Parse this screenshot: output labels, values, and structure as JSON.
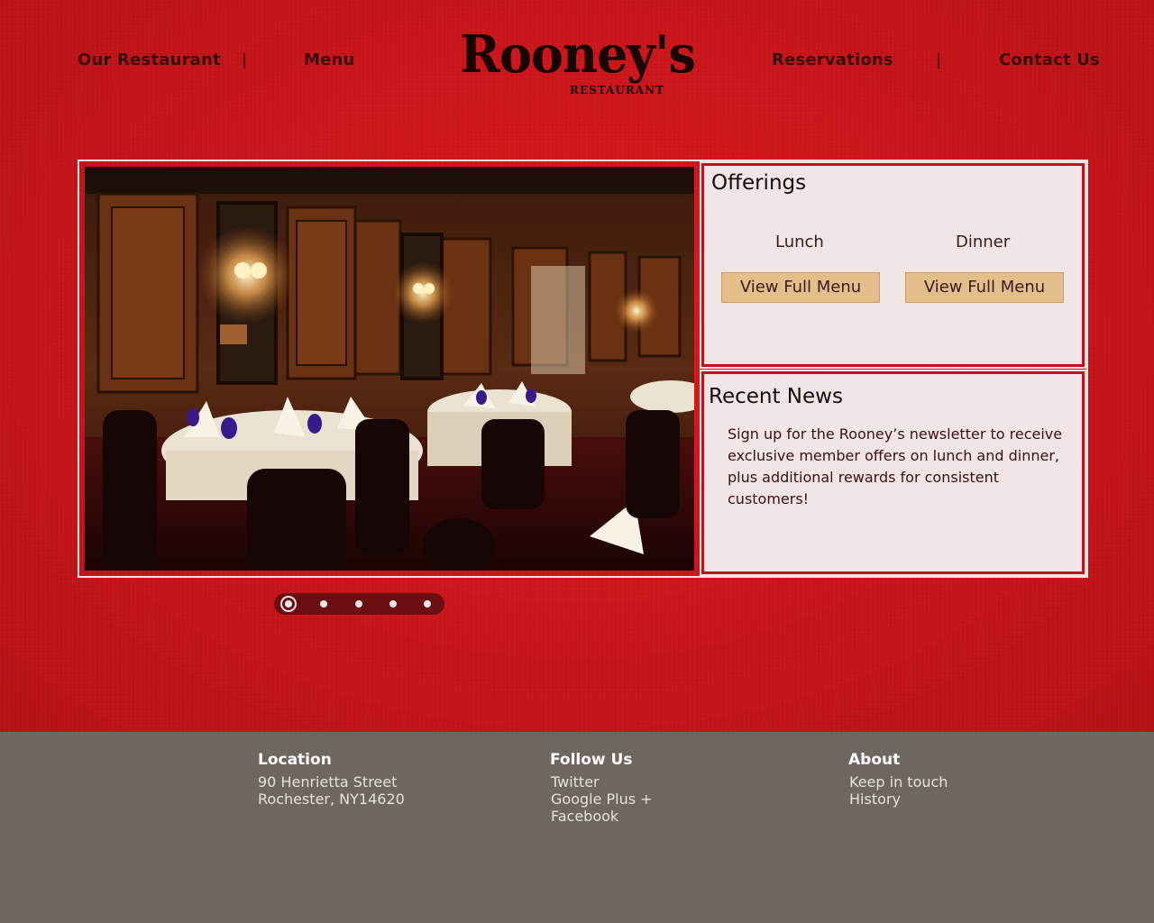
{
  "nav": {
    "our_restaurant": "Our Restaurant",
    "menu": "Menu",
    "reservations": "Reservations",
    "contact_us": "Contact Us",
    "separator": "|"
  },
  "logo": {
    "name": "Rooney's",
    "subtitle": "RESTAURANT"
  },
  "offerings": {
    "title": "Offerings",
    "lunch_label": "Lunch",
    "dinner_label": "Dinner",
    "lunch_button": "View Full Menu",
    "dinner_button": "View Full Menu"
  },
  "news": {
    "title": "Recent News",
    "body": "Sign up for the Rooney’s newsletter to receive exclusive member offers on lunch and dinner, plus additional rewards for consistent customers!"
  },
  "slideshow": {
    "slide_count": 5,
    "active_slide": 1
  },
  "footer": {
    "location": {
      "heading": "Location",
      "street": "90 Henrietta Street",
      "city": "Rochester, NY14620"
    },
    "follow": {
      "heading": "Follow Us",
      "twitter": "Twitter",
      "google": "Google Plus +",
      "facebook": "Facebook"
    },
    "about": {
      "heading": "About",
      "keep_in_touch": "Keep in touch",
      "history": "History"
    }
  },
  "colors": {
    "background_red": "#cc161b",
    "panel_bg": "#f2e5e6",
    "button_tan": "#e2bf8b",
    "footer_gray": "#6e675f"
  }
}
